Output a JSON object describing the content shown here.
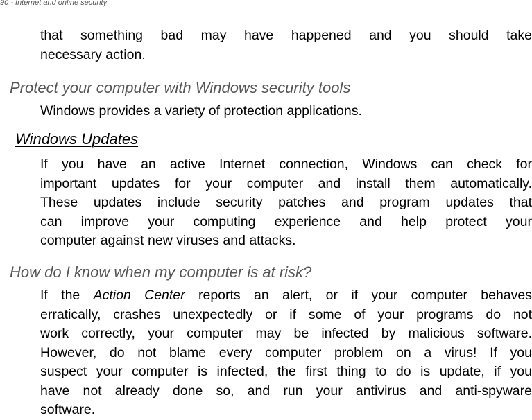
{
  "page_header": "90 - Internet and online security",
  "intro": {
    "line1": "that something bad may have happened and you should take",
    "line2": "necessary action."
  },
  "section_protect": {
    "heading": "Protect your computer with Windows security tools",
    "body": "Windows provides a variety of protection applications."
  },
  "section_updates": {
    "heading": "Windows Updates",
    "lines": [
      "If you have an active Internet connection, Windows can check for",
      "important updates for your computer and install them automatically.",
      "These updates include security patches and program updates that",
      "can improve your computing experience and help protect your",
      "computer against new viruses and attacks."
    ]
  },
  "section_risk": {
    "heading": "How do I know when my computer is at risk?",
    "line1_prefix": "If the ",
    "line1_emphasis": "Action Center",
    "line1_suffix": " reports an alert, or if your computer behaves",
    "lines": [
      "erratically, crashes unexpectedly or if some of your programs do not",
      "work correctly, your computer may be infected by malicious software.",
      "However, do not blame every computer problem on a virus! If you",
      "suspect your computer is infected, the first thing to do is update, if you",
      "have not already done so, and run your antivirus and anti-spyware",
      "software."
    ]
  }
}
